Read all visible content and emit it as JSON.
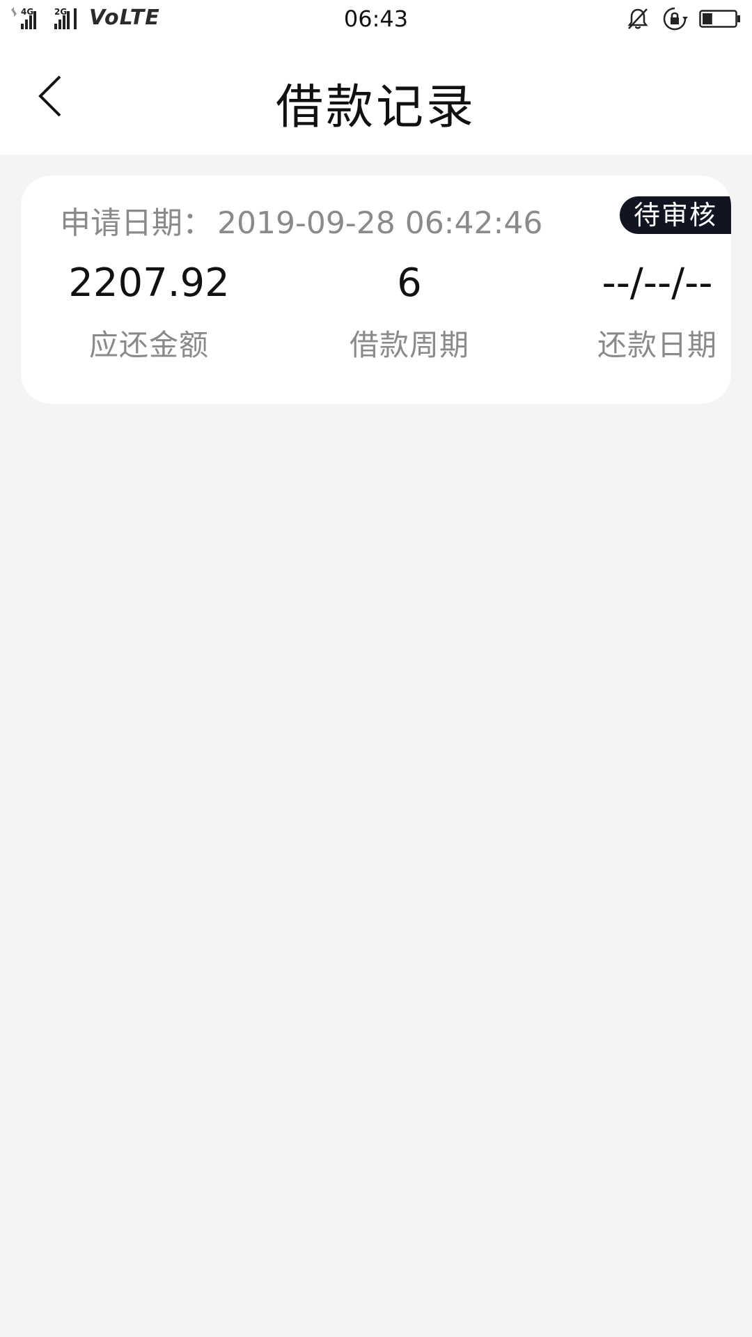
{
  "status_bar": {
    "net1": "4G",
    "net2": "2G",
    "volte": "VoLTE",
    "time": "06:43",
    "battery_level": 0.3
  },
  "nav": {
    "title": "借款记录"
  },
  "record": {
    "apply_date_label": "申请日期：",
    "apply_date_value": "2019-09-28 06:42:46",
    "status": "待审核",
    "amount_value": "2207.92",
    "amount_label": "应还金额",
    "period_value": "6",
    "period_label": "借款周期",
    "repay_date_value": "--/--/--",
    "repay_date_label": "还款日期"
  }
}
